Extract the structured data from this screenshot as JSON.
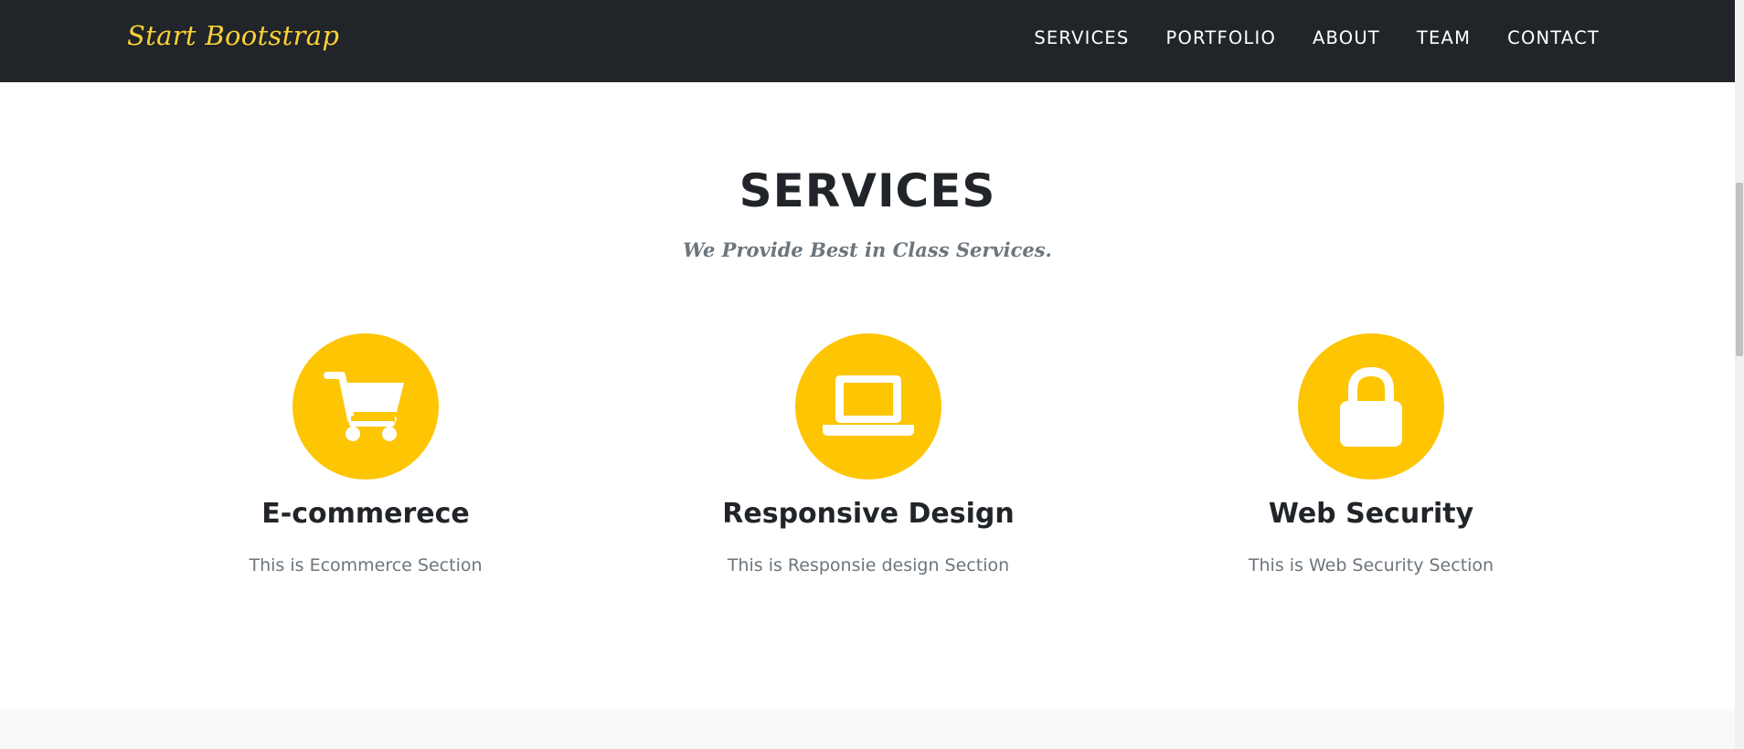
{
  "navbar": {
    "brand": "Start Bootstrap",
    "links": [
      {
        "label": "SERVICES"
      },
      {
        "label": "PORTFOLIO"
      },
      {
        "label": "ABOUT"
      },
      {
        "label": "TEAM"
      },
      {
        "label": "CONTACT"
      }
    ]
  },
  "services": {
    "heading": "SERVICES",
    "subheading": "We Provide Best in Class Services.",
    "items": [
      {
        "icon": "shopping-cart-icon",
        "title": "E-commerece",
        "text": "This is Ecommerce Section"
      },
      {
        "icon": "laptop-icon",
        "title": "Responsive Design",
        "text": "This is Responsie design Section"
      },
      {
        "icon": "lock-icon",
        "title": "Web Security",
        "text": "This is Web Security Section"
      }
    ]
  },
  "colors": {
    "navbar_bg": "#212529",
    "brand": "#fed136",
    "accent": "#fec503",
    "heading": "#212529",
    "muted": "#6c757d",
    "next_section_bg": "#f8f9fa"
  }
}
